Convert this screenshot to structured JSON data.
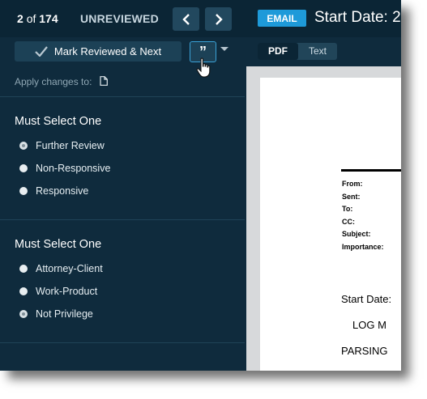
{
  "pager": {
    "current": "2",
    "of": "of",
    "total": "174",
    "status": "UNREVIEWED"
  },
  "nav": {
    "prev_icon": "chevron-left-icon",
    "next_icon": "chevron-right-icon"
  },
  "document_header": {
    "badge": "EMAIL",
    "title": "Start Date: 2"
  },
  "toolbar": {
    "mark_reviewed_label": "Mark Reviewed & Next",
    "quote_glyph": "”",
    "quote_icon": "quote-icon"
  },
  "view_tabs": [
    {
      "label": "PDF",
      "active": true
    },
    {
      "label": "Text",
      "active": false
    }
  ],
  "apply_changes": {
    "label": "Apply changes to:",
    "icon": "document-icon"
  },
  "groups": [
    {
      "title": "Must Select One",
      "options": [
        {
          "label": "Further Review",
          "selected": true
        },
        {
          "label": "Non-Responsive",
          "selected": false
        },
        {
          "label": "Responsive",
          "selected": false
        }
      ]
    },
    {
      "title": "Must Select One",
      "options": [
        {
          "label": "Attorney-Client",
          "selected": false
        },
        {
          "label": "Work-Product",
          "selected": false
        },
        {
          "label": "Not Privilege",
          "selected": true
        }
      ]
    }
  ],
  "document": {
    "header_labels": [
      "From:",
      "Sent:",
      "To:",
      "CC:",
      "Subject:",
      "Importance:"
    ],
    "body_lines": [
      "Start Date:",
      "LOG M",
      "PARSING"
    ]
  },
  "colors": {
    "accent": "#1e9ad9",
    "panel": "#0f2b3d",
    "topbar": "#0b2535"
  }
}
